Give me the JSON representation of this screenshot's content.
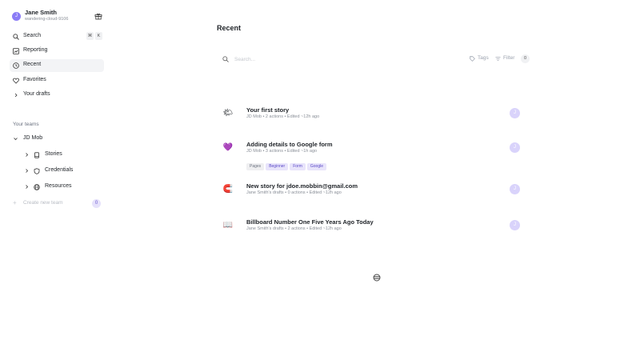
{
  "user": {
    "name": "Jane Smith",
    "handle": "wandering-cloud-9106",
    "avatar_initial": "J",
    "gift_icon": "gift-icon"
  },
  "nav": {
    "search": {
      "label": "Search",
      "shortcut_mod": "⌘",
      "shortcut_key": "K",
      "icon": "search-icon"
    },
    "reporting": {
      "label": "Reporting",
      "icon": "chart-icon"
    },
    "recent": {
      "label": "Recent",
      "icon": "clock-icon"
    },
    "favorites": {
      "label": "Favorites",
      "icon": "heart-icon"
    },
    "drafts": {
      "label": "Your drafts",
      "icon": "chevron-right-icon"
    }
  },
  "teams": {
    "section_label": "Your teams",
    "team_name": "JD Mob",
    "children": [
      {
        "label": "Stories",
        "icon": "book-icon"
      },
      {
        "label": "Credentials",
        "icon": "shield-icon"
      },
      {
        "label": "Resources",
        "icon": "globe-icon"
      }
    ],
    "create_label": "Create new team",
    "create_badge": "0"
  },
  "main": {
    "title": "Recent",
    "search_placeholder": "Search...",
    "tags_label": "Tags",
    "filter_label": "Filter",
    "filter_count": "0"
  },
  "stories": [
    {
      "title": "Your first story",
      "meta": "JD Mob  •  2 actions  •  Edited ~12h ago",
      "emoji": "🌤",
      "avatar": "J",
      "tags": []
    },
    {
      "title": "Adding details to Google form",
      "meta": "JD Mob  •  3 actions  •  Edited ~1h ago",
      "emoji": "💜",
      "avatar": "J",
      "tags": [
        "Pages",
        "Beginner",
        "Form",
        "Google"
      ]
    },
    {
      "title": "New story for jdoe.mobbin@gmail.com",
      "meta": "Jane Smith's drafts  •  0 actions  •  Edited ~12h ago",
      "emoji": "🧲",
      "avatar": "J",
      "tags": []
    },
    {
      "title": "Billboard Number One Five Years Ago Today",
      "meta": "Jane Smith's drafts  •  2 actions  •  Edited ~12h ago",
      "emoji": "📖",
      "avatar": "J",
      "tags": []
    }
  ],
  "colors": {
    "accent": "#8b7cf6",
    "avatar_soft": "#d9d3fb",
    "active_nav_bg": "#f3f4f6"
  }
}
